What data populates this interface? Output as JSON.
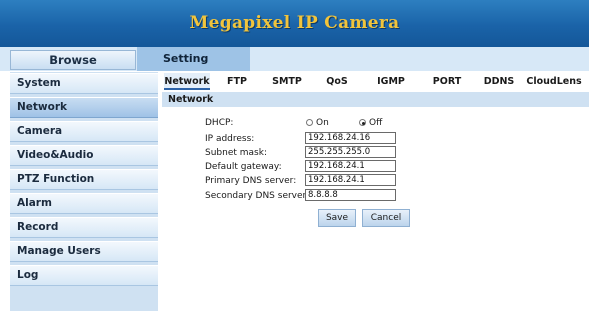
{
  "header": {
    "title": "Megapixel IP Camera"
  },
  "topbar": {
    "browse_label": "Browse",
    "setting_label": "Setting"
  },
  "sidebar": {
    "items": [
      {
        "label": "System"
      },
      {
        "label": "Network"
      },
      {
        "label": "Camera"
      },
      {
        "label": "Video&Audio"
      },
      {
        "label": "PTZ Function"
      },
      {
        "label": "Alarm"
      },
      {
        "label": "Record"
      },
      {
        "label": "Manage Users"
      },
      {
        "label": "Log"
      }
    ],
    "active": "Network"
  },
  "tabs": [
    {
      "label": "Network"
    },
    {
      "label": "FTP"
    },
    {
      "label": "SMTP"
    },
    {
      "label": "QoS"
    },
    {
      "label": "IGMP"
    },
    {
      "label": "PORT"
    },
    {
      "label": "DDNS"
    },
    {
      "label": "CloudLens"
    }
  ],
  "section": {
    "title": "Network"
  },
  "form": {
    "dhcp_label": "DHCP:",
    "dhcp_on": "On",
    "dhcp_off": "Off",
    "dhcp_selected": "Off",
    "ip_label": "IP address:",
    "ip_value": "192.168.24.16",
    "mask_label": "Subnet mask:",
    "mask_value": "255.255.255.0",
    "gw_label": "Default gateway:",
    "gw_value": "192.168.24.1",
    "dns1_label": "Primary DNS server:",
    "dns1_value": "192.168.24.1",
    "dns2_label": "Secondary DNS server:",
    "dns2_value": "8.8.8.8",
    "save_label": "Save",
    "cancel_label": "Cancel"
  },
  "colors": {
    "title": "#f1c43c",
    "header_blue": "#1a63a8",
    "sidebar_bg": "#cfe1f2"
  }
}
